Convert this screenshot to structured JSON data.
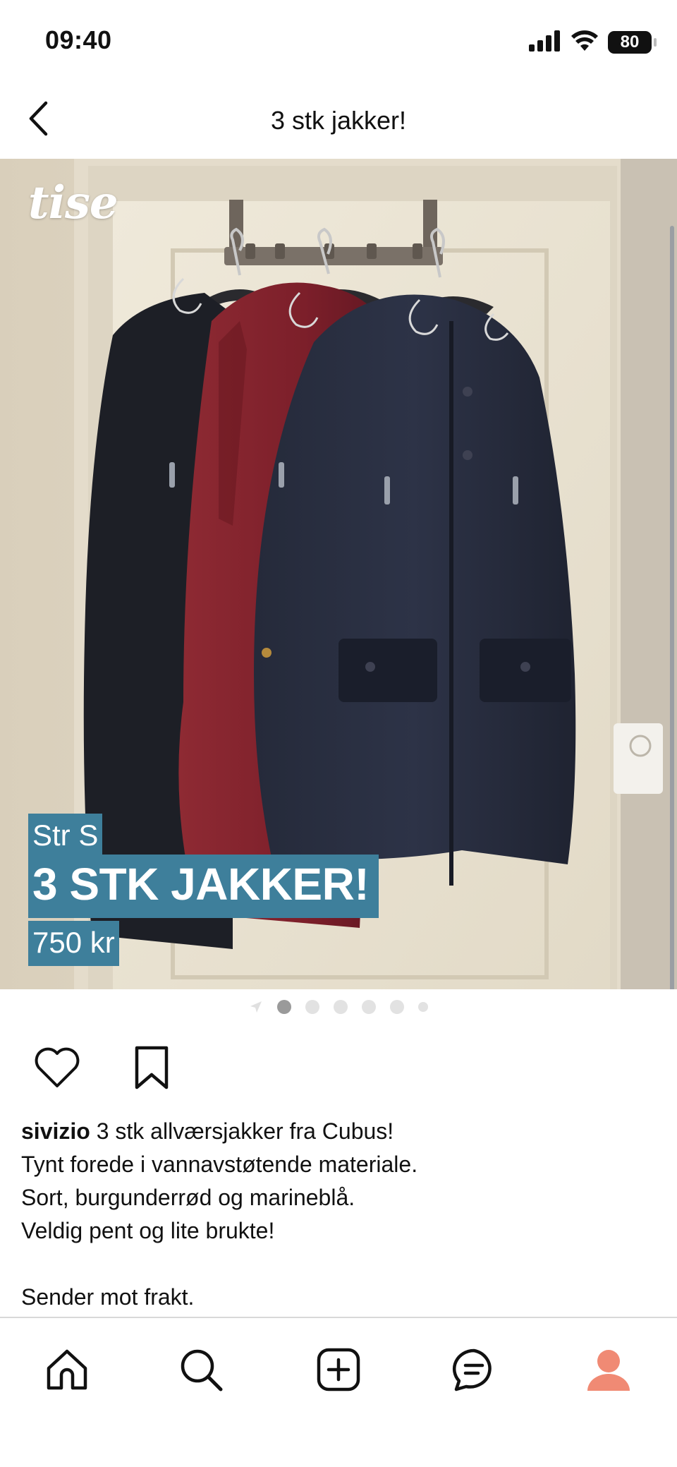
{
  "status_bar": {
    "time": "09:40",
    "battery": "80",
    "icons": [
      "signal-icon",
      "wifi-icon",
      "battery-icon"
    ]
  },
  "header": {
    "title": "3 stk jakker!",
    "back_icon": "chevron-left-icon"
  },
  "listing_image": {
    "logo": "tise",
    "size_label": "Str S",
    "title_overlay": "3 STK JAKKER!",
    "price_overlay": "750 kr",
    "overlay_color": "#3e7f9b"
  },
  "pagination": {
    "total": 6,
    "active": 1
  },
  "actions": {
    "like_icon": "heart-icon",
    "save_icon": "bookmark-icon"
  },
  "description": {
    "username": "sivizio",
    "lines": [
      "3 stk allværsjakker fra Cubus!",
      "Tynt forede i vannavstøtende materiale.",
      "Sort, burgunderrød og marineblå.",
      "Veldig pent og lite brukte!",
      "",
      "Sender mot frakt."
    ]
  },
  "tab_bar": {
    "items": [
      "home-icon",
      "search-icon",
      "add-icon",
      "messages-icon",
      "profile-icon"
    ],
    "active_color": "#f08a74"
  }
}
